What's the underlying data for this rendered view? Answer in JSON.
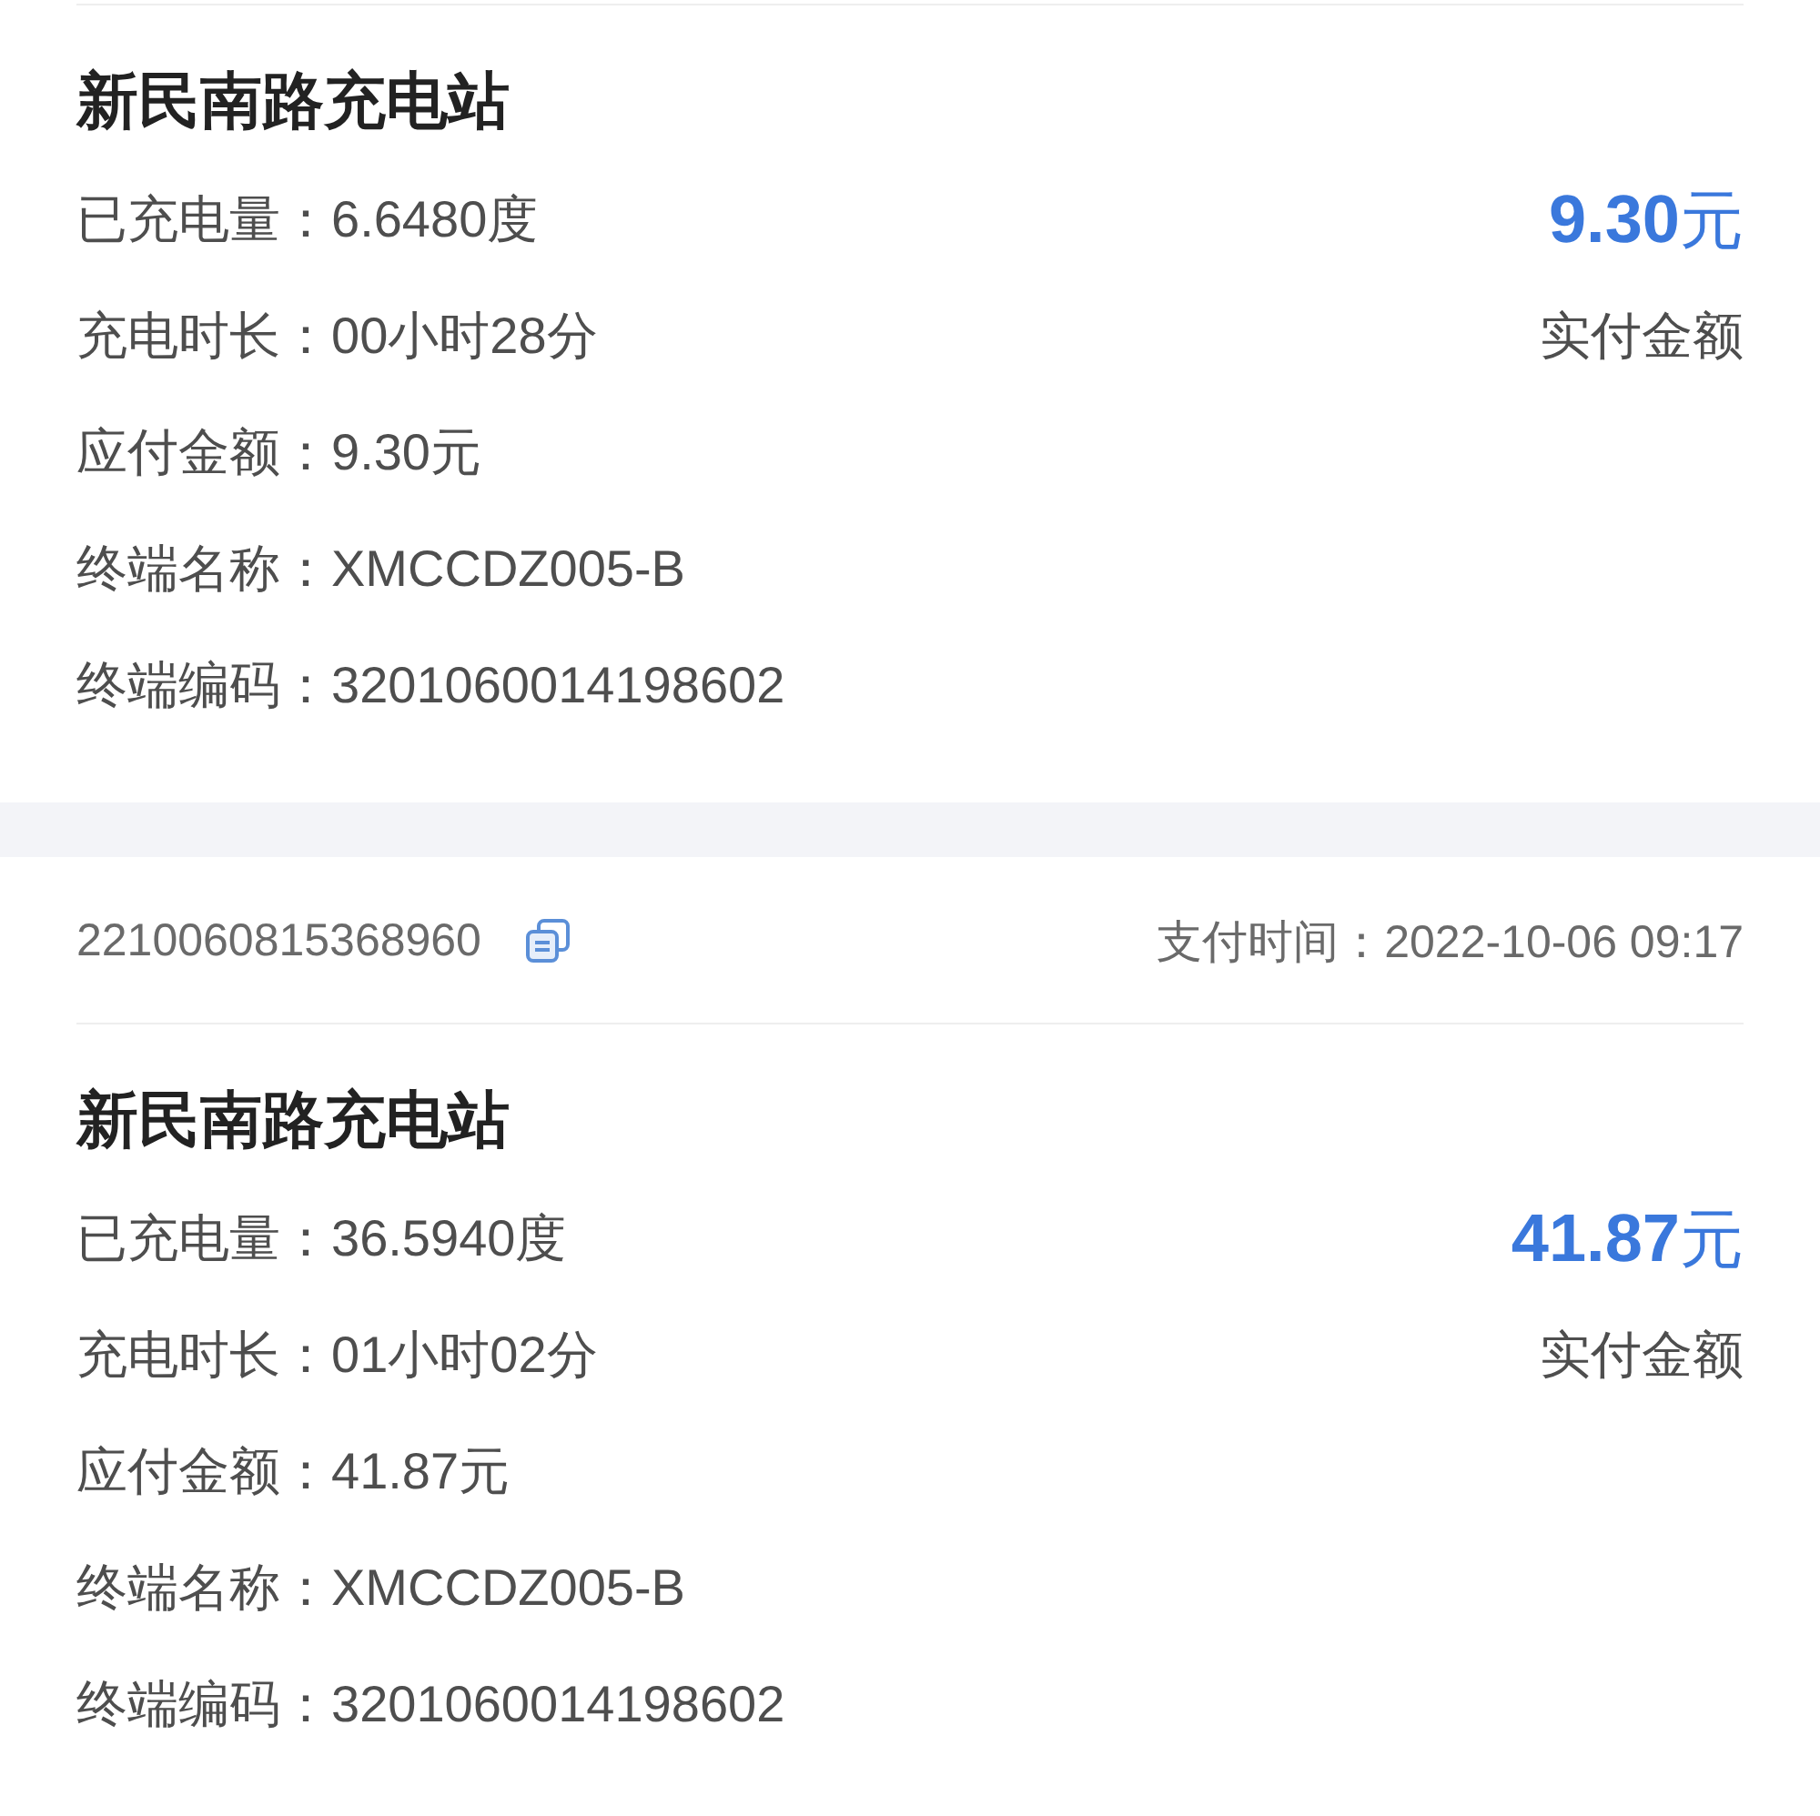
{
  "orders": [
    {
      "station": "新民南路充电站",
      "details": [
        "已充电量：6.6480度",
        "充电时长：00小时28分",
        "应付金额：9.30元",
        "终端名称：XMCCDZ005-B",
        "终端编码：3201060014198602"
      ],
      "amount": "**9.30**元",
      "amount_label": "实付金额"
    },
    {
      "order_no": "2210060815368960",
      "payment_time": "支付时间：2022-10-06 09:17",
      "station": "新民南路充电站",
      "details": [
        "已充电量：36.5940度",
        "充电时长：01小时02分",
        "应付金额：41.87元",
        "终端名称：XMCCDZ005-B",
        "终端编码：3201060014198602"
      ],
      "amount": "**41.87**元",
      "amount_label": "实付金额"
    }
  ]
}
